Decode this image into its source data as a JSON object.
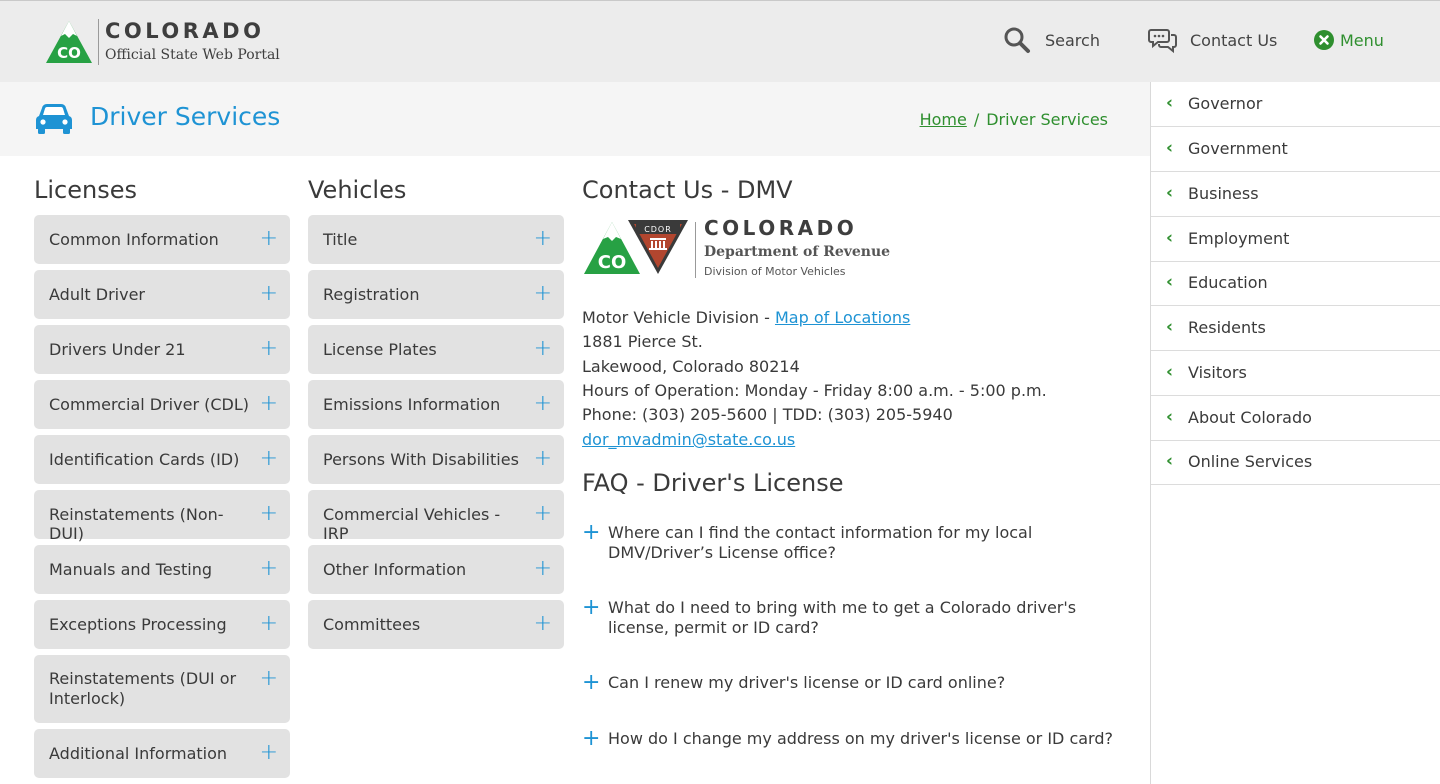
{
  "header": {
    "brand_title": "COLORADO",
    "brand_subtitle": "Official State Web Portal",
    "logo_text": "CO",
    "search_label": "Search",
    "contact_label": "Contact Us",
    "menu_label": "Menu"
  },
  "page": {
    "title": "Driver Services",
    "breadcrumb_home": "Home",
    "breadcrumb_sep": "/",
    "breadcrumb_current": "Driver Services"
  },
  "licenses": {
    "heading": "Licenses",
    "items": [
      "Common Information",
      "Adult Driver",
      "Drivers Under 21",
      "Commercial Driver (CDL)",
      "Identification Cards (ID)",
      "Reinstatements (Non-DUI)",
      "Manuals and Testing",
      "Exceptions Processing",
      "Reinstatements (DUI or Interlock)",
      "Additional Information"
    ]
  },
  "vehicles": {
    "heading": "Vehicles",
    "items": [
      "Title",
      "Registration",
      "License Plates",
      "Emissions Information",
      "Persons With Disabilities",
      "Commercial Vehicles - IRP",
      "Other Information",
      "Committees"
    ]
  },
  "accordion_icon": "+",
  "contact": {
    "heading": "Contact Us - DMV",
    "logo_badge": "CDOR",
    "logo_text": "CO",
    "org_title": "COLORADO",
    "org_dept": "Department of Revenue",
    "org_division": "Division of Motor Vehicles",
    "division_prefix": "Motor Vehicle Division - ",
    "map_link": "Map of Locations",
    "street": "1881 Pierce St.",
    "city": "Lakewood, Colorado 80214",
    "hours": "Hours of Operation: Monday - Friday 8:00 a.m. - 5:00 p.m.",
    "phone": "Phone: (303) 205-5600 | TDD: (303) 205-5940",
    "email": "dor_mvadmin@state.co.us"
  },
  "faq": {
    "heading": "FAQ - Driver's License",
    "items": [
      "Where can I find the contact information for my local DMV/Driver’s License office?",
      "What do I need to bring with me to get a Colorado driver's license, permit or ID card?",
      "Can I renew my driver's license or ID card online?",
      "How do I change my address on my driver's license or ID card?"
    ]
  },
  "sidebar": {
    "chevron": "‹",
    "items": [
      "Governor",
      "Government",
      "Business",
      "Employment",
      "Education",
      "Residents",
      "Visitors",
      "About Colorado",
      "Online Services"
    ]
  },
  "colors": {
    "accent_blue": "#1e93d4",
    "accent_green": "#2f8f2f",
    "logo_green": "#27a144",
    "cdor_red": "#b2462f"
  }
}
